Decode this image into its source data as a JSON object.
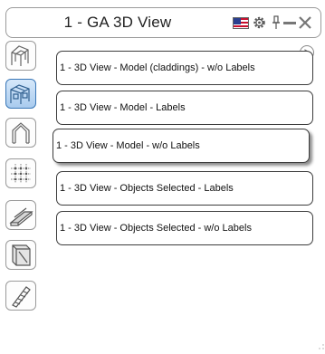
{
  "header": {
    "title": "1 - GA 3D View",
    "icons": [
      "flag-icon",
      "gear-icon",
      "pin-icon",
      "minimize-icon",
      "close-icon"
    ]
  },
  "toolbar": {
    "tools": [
      {
        "name": "3d-frame-tool",
        "active": false
      },
      {
        "name": "3d-views-tool",
        "active": true
      },
      {
        "name": "gable-frame-tool",
        "active": false
      },
      {
        "name": "grid-tool",
        "active": false
      },
      {
        "name": "beam-section-tool",
        "active": false
      },
      {
        "name": "column-tool",
        "active": false
      },
      {
        "name": "stair-tool",
        "active": false
      }
    ]
  },
  "views": [
    {
      "label": "1 - 3D View - Model (claddings) - w/o Labels",
      "selected": false
    },
    {
      "label": "1 - 3D View - Model - Labels",
      "selected": false
    },
    {
      "label": "1 - 3D View - Model - w/o Labels",
      "selected": true
    },
    {
      "label": "1 - 3D View - Objects Selected - Labels",
      "selected": false
    },
    {
      "label": "1 - 3D View - Objects Selected - w/o Labels",
      "selected": false
    }
  ],
  "colors": {
    "border": "#3c3c3c",
    "active_tool": "#a9cbee",
    "flag_red": "#c8102e",
    "flag_blue": "#2a3f8f"
  }
}
